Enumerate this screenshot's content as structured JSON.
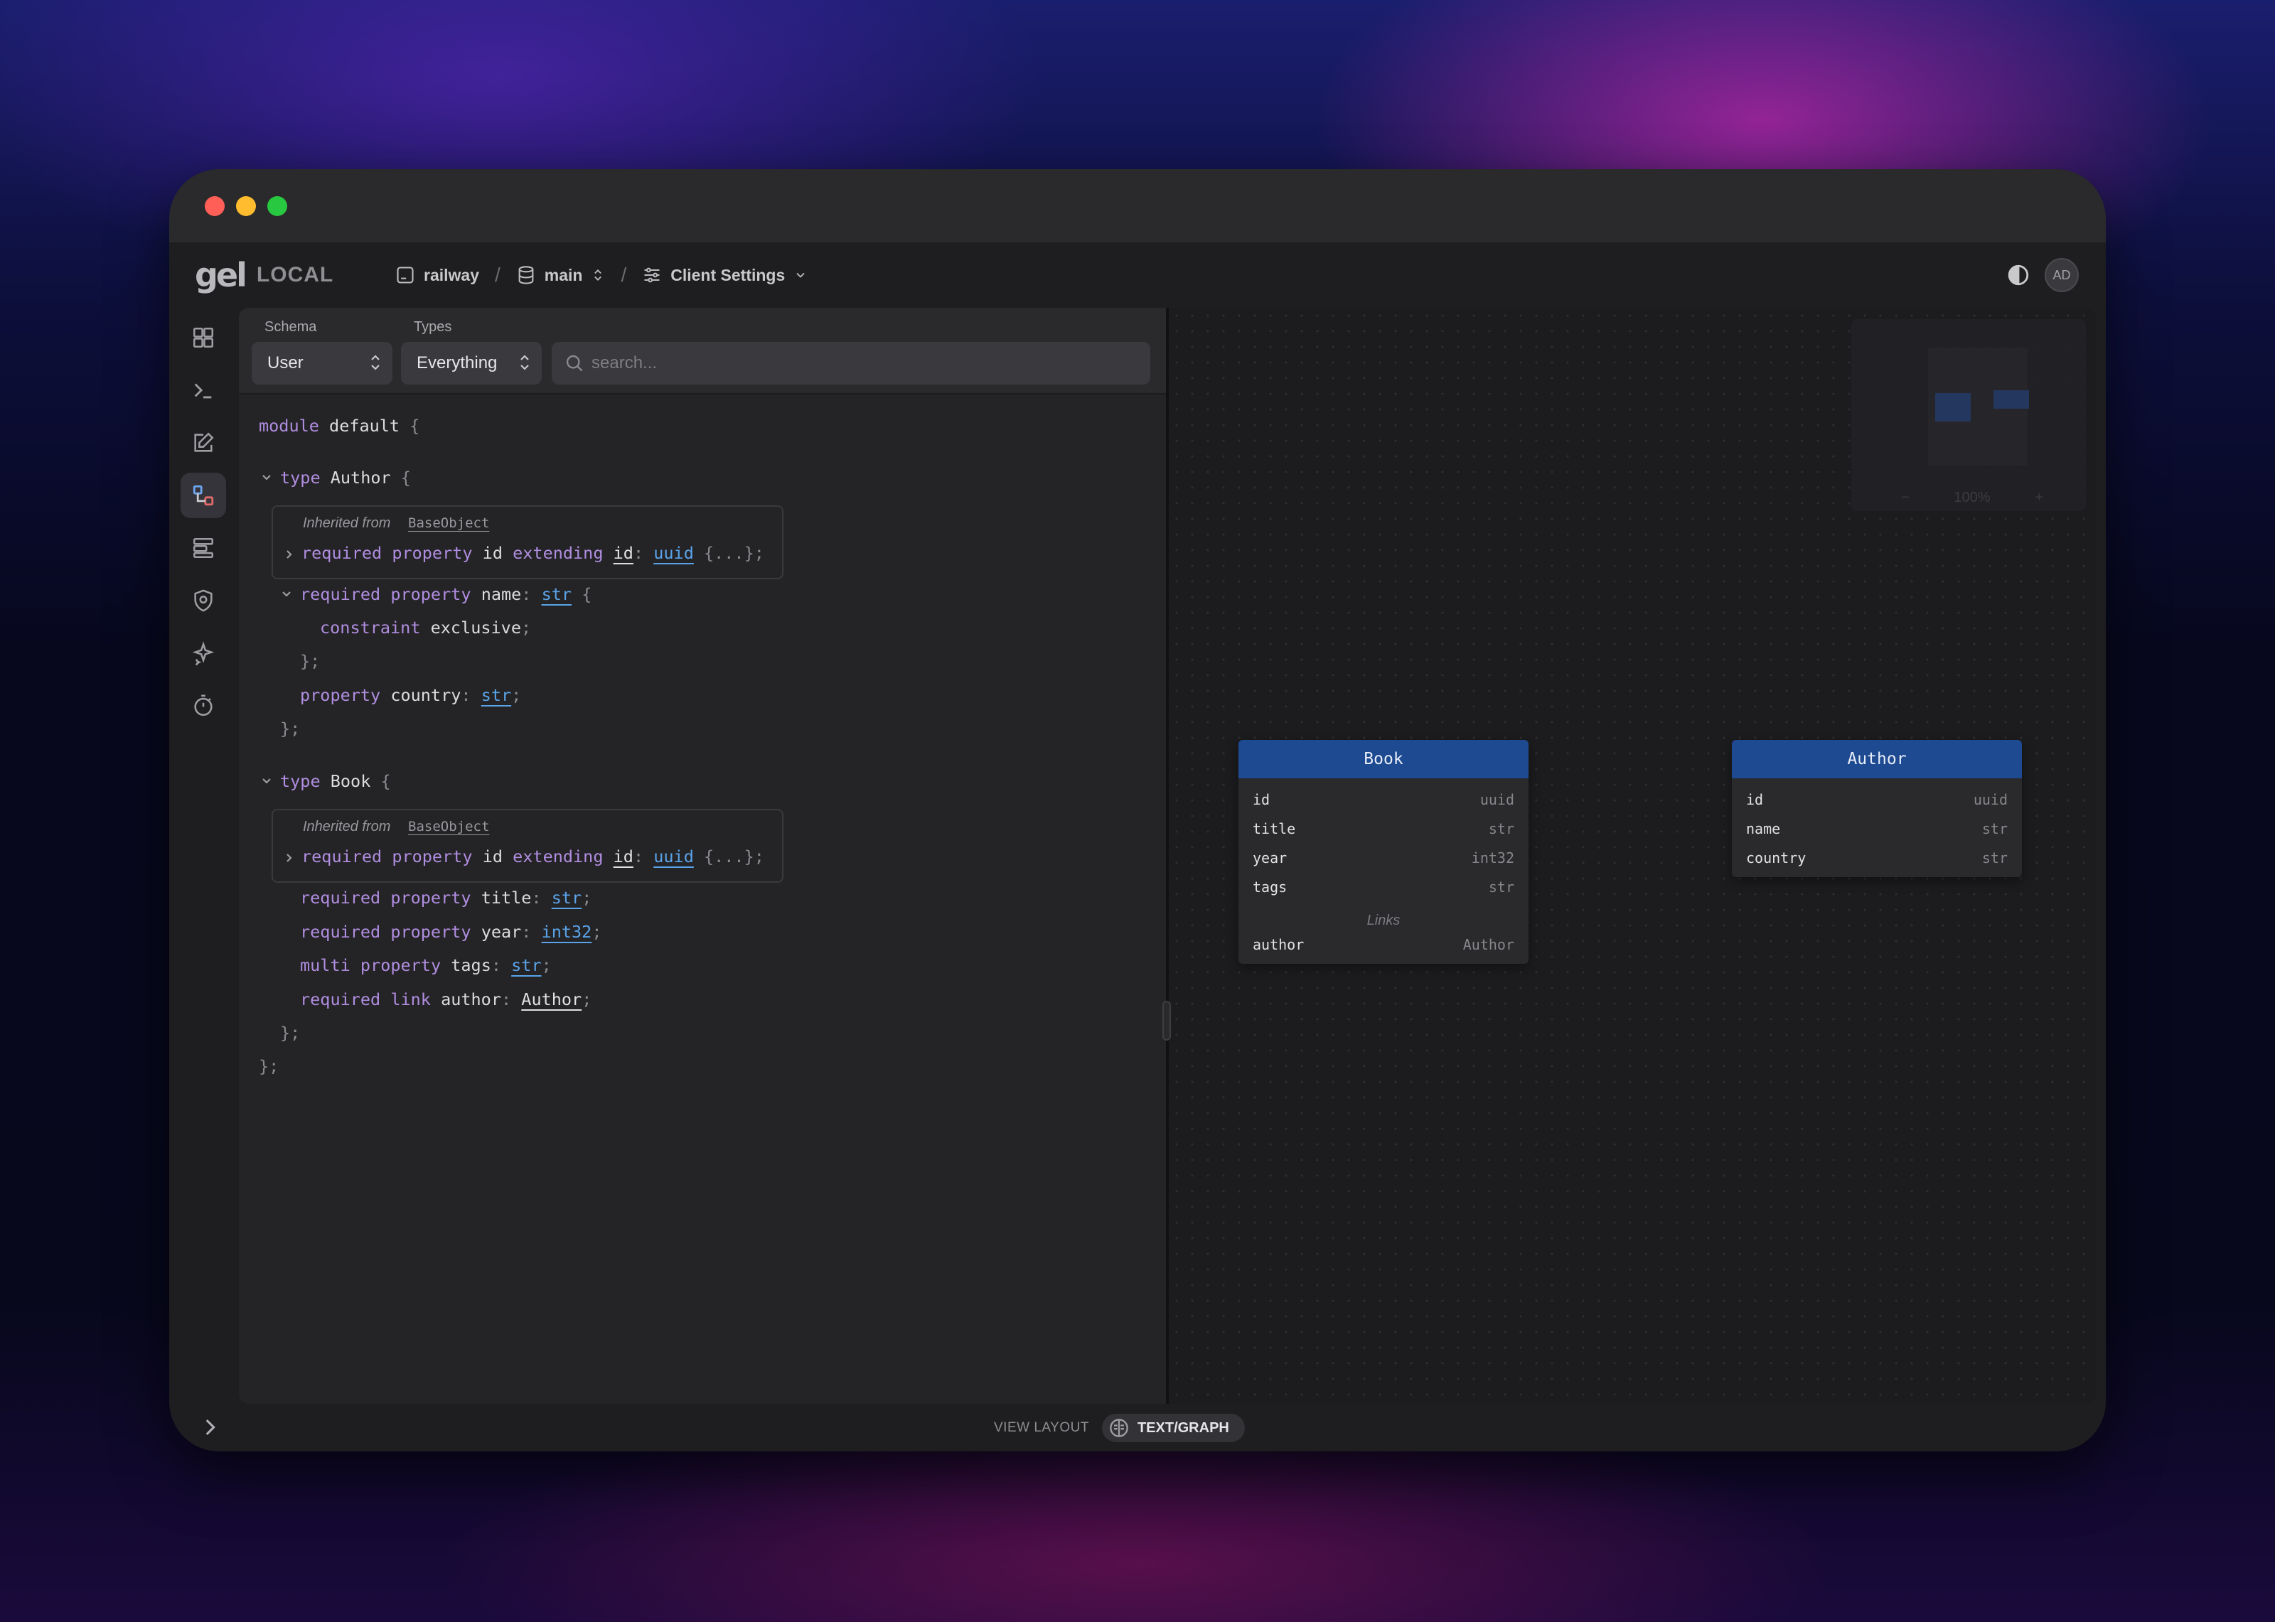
{
  "app": {
    "logo_mark": "gel",
    "instance_badge": "LOCAL"
  },
  "breadcrumbs": {
    "instance": "railway",
    "branch": "main",
    "settings": "Client Settings"
  },
  "user": {
    "initials": "AD"
  },
  "sidebar": {
    "items": [
      {
        "icon": "dashboard-icon"
      },
      {
        "icon": "repl-icon"
      },
      {
        "icon": "editor-icon"
      },
      {
        "icon": "schema-icon",
        "active": true
      },
      {
        "icon": "data-explorer-icon"
      },
      {
        "icon": "auth-icon"
      },
      {
        "icon": "ai-icon"
      },
      {
        "icon": "performance-icon"
      }
    ]
  },
  "filters": {
    "schema_label": "Schema",
    "schema_value": "User",
    "types_label": "Types",
    "types_value": "Everything",
    "search_placeholder": "search..."
  },
  "code": {
    "module_kw": "module",
    "module_name": "default",
    "inherited_label": "Inherited from",
    "inherited_base": "BaseObject",
    "types": [
      {
        "name": "Author",
        "id_line": {
          "req": "required",
          "prop": "property",
          "name": "id",
          "ext": "extending",
          "base": "id",
          "type": "uuid",
          "collapsed": "{...}"
        },
        "name_prop": {
          "req": "required",
          "prop": "property",
          "name": "name",
          "type": "str"
        },
        "constraint": {
          "kw": "constraint",
          "name": "exclusive"
        },
        "country_prop": {
          "prop": "property",
          "name": "country",
          "type": "str"
        }
      },
      {
        "name": "Book",
        "id_line": {
          "req": "required",
          "prop": "property",
          "name": "id",
          "ext": "extending",
          "base": "id",
          "type": "uuid",
          "collapsed": "{...}"
        },
        "title_prop": {
          "req": "required",
          "prop": "property",
          "name": "title",
          "type": "str"
        },
        "year_prop": {
          "req": "required",
          "prop": "property",
          "name": "year",
          "type": "int32"
        },
        "tags_prop": {
          "multi": "multi",
          "prop": "property",
          "name": "tags",
          "type": "str"
        },
        "author_link": {
          "req": "required",
          "link": "link",
          "name": "author",
          "type": "Author"
        }
      }
    ]
  },
  "graph": {
    "minimap_zoom": "100%",
    "book": {
      "title": "Book",
      "props": [
        {
          "name": "id",
          "type": "uuid"
        },
        {
          "name": "title",
          "type": "str"
        },
        {
          "name": "year",
          "type": "int32"
        },
        {
          "name": "tags",
          "type": "str"
        }
      ],
      "links_label": "Links",
      "links": [
        {
          "name": "author",
          "target": "Author"
        }
      ]
    },
    "author": {
      "title": "Author",
      "props": [
        {
          "name": "id",
          "type": "uuid"
        },
        {
          "name": "name",
          "type": "str"
        },
        {
          "name": "country",
          "type": "str"
        }
      ]
    }
  },
  "footer": {
    "view_layout_label": "VIEW LAYOUT",
    "view_layout_value": "TEXT/GRAPH"
  }
}
